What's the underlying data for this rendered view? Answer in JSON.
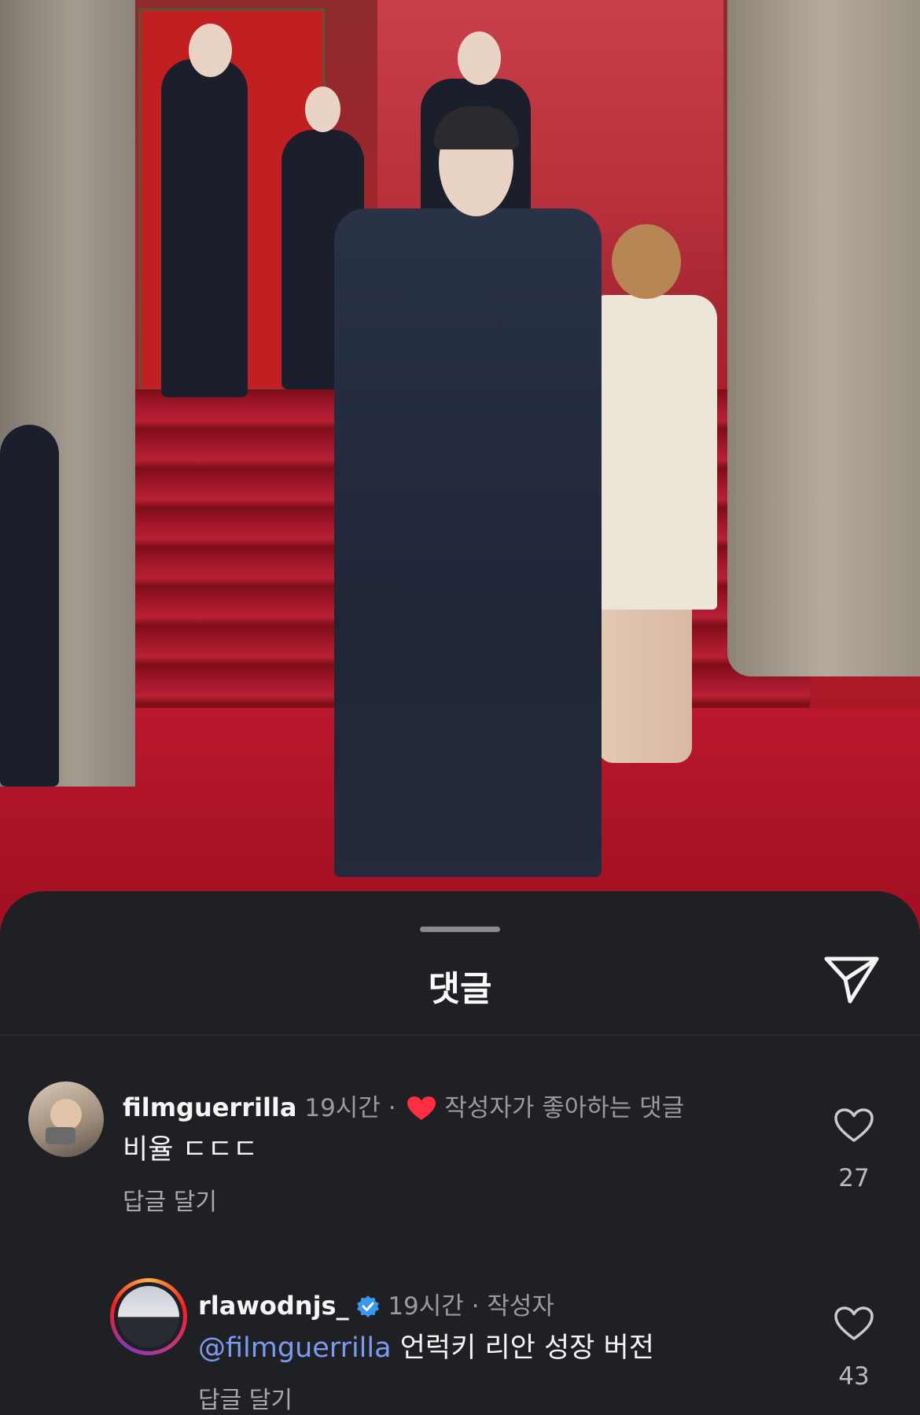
{
  "sheet": {
    "title": "댓글",
    "share_icon": "paper-plane-icon"
  },
  "comments": [
    {
      "username": "filmguerrilla",
      "time": "19시간",
      "separator": "·",
      "creator_liked_label": "작성자가 좋아하는 댓글",
      "text": "비율 ㄷㄷㄷ",
      "reply_label": "답글 달기",
      "likes": "27"
    },
    {
      "username": "rlawodnjs_",
      "verified": true,
      "time": "19시간",
      "separator": "·",
      "author_label": "작성자",
      "mention": "@filmguerrilla",
      "text": "언럭키 리안 성장 버전",
      "reply_label": "답글 달기",
      "likes": "43"
    }
  ],
  "colors": {
    "sheet_bg": "#1f2024",
    "heart_red": "#ff2d3f",
    "verified_blue": "#3897f0",
    "mention_blue": "#7b9bf2"
  }
}
